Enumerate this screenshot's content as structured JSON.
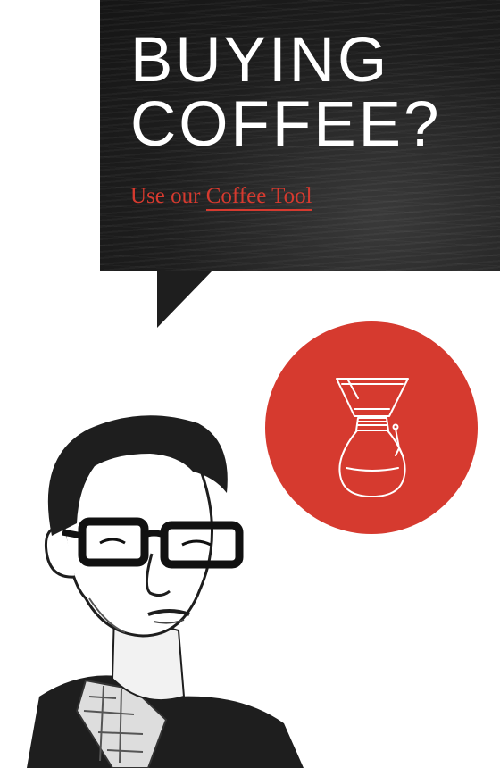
{
  "promo": {
    "headline": "BUYING\nCOFFEE?",
    "tagline_prefix": "Use our ",
    "tagline_link": "Coffee Tool"
  },
  "colors": {
    "accent": "#d63a2f",
    "banner_background": "#1e1e1e",
    "page_background": "#ffffff"
  },
  "icons": {
    "brewer": "coffee-brewer-icon",
    "portrait": "man-with-glasses-illustration"
  }
}
